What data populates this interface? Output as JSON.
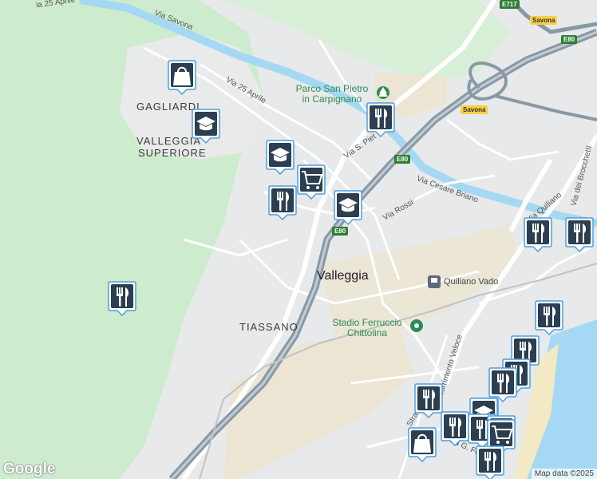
{
  "map": {
    "attribution": "Map data ©2025",
    "logo": "Google",
    "colors": {
      "land": "#e8e9ea",
      "green": "#cdeccd",
      "water": "#a5d9f3",
      "highway": "#8899a6",
      "marker": "#2c3e50"
    }
  },
  "labels": {
    "gagliardi": "GAGLIARDI",
    "valleggia_sup_1": "VALLEGGIA",
    "valleggia_sup_2": "SUPERIORE",
    "tiassano": "TIASSANO",
    "valleggia": "Valleggia",
    "parco_1": "Parco San Pietro",
    "parco_2": "in Carpignano",
    "quiliano_vado": "Quiliano Vado",
    "stadio_1": "Stadio Ferruccio",
    "stadio_2": "Chittolina",
    "via_savona": "Via Savona",
    "via_25_aprile": "Via 25 Aprile",
    "via_25_aprile_top": "ia 25 Aprile",
    "via_s_pietro": "Via S. Piet",
    "via_cesare_briano": "Via Cesare Briano",
    "via_rossi": "Via Rossi",
    "via_quiliano": "Via Quiliano",
    "via_dei_brocchetti": "Via dei Brocchetti",
    "scorrimento_veloce": "Scorrimento Veloce",
    "via_g_ferr": "Via G. Ferr",
    "strada": "Stra"
  },
  "shields": {
    "e717": "E717",
    "savona_top": "Savona",
    "e80_a": "E80",
    "savona_mid": "Savona",
    "e80_b": "E80",
    "e80_c": "E80"
  },
  "markers": [
    {
      "icon": "shopping-bag-icon"
    },
    {
      "icon": "school-icon"
    },
    {
      "icon": "restaurant-icon"
    },
    {
      "icon": "school-icon"
    },
    {
      "icon": "shopping-cart-icon"
    },
    {
      "icon": "restaurant-icon"
    },
    {
      "icon": "school-icon"
    },
    {
      "icon": "restaurant-icon"
    },
    {
      "icon": "restaurant-icon"
    },
    {
      "icon": "restaurant-icon"
    },
    {
      "icon": "restaurant-icon"
    },
    {
      "icon": "restaurant-icon"
    },
    {
      "icon": "restaurant-icon"
    },
    {
      "icon": "restaurant-icon"
    },
    {
      "icon": "restaurant-icon"
    },
    {
      "icon": "restaurant-icon"
    },
    {
      "icon": "restaurant-icon"
    },
    {
      "icon": "school-icon"
    },
    {
      "icon": "restaurant-icon"
    },
    {
      "icon": "restaurant-icon"
    },
    {
      "icon": "shopping-cart-icon"
    },
    {
      "icon": "shopping-bag-icon"
    },
    {
      "icon": "restaurant-icon"
    }
  ]
}
